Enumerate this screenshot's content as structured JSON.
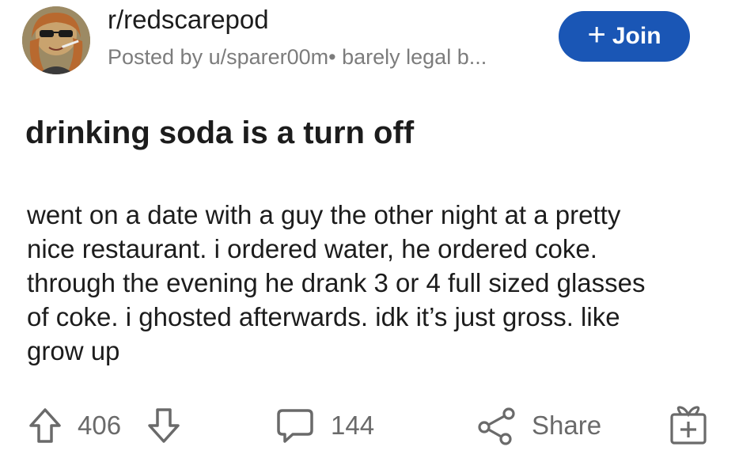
{
  "post": {
    "subreddit": "r/redscarepod",
    "posted_by": "Posted by u/sparer00m• barely legal b...",
    "join_label": "Join",
    "join_plus": "+",
    "title": "drinking soda is a turn off",
    "body_lines": [
      "went on a date with a guy the other night at a pretty",
      "nice restaurant. i ordered water, he ordered coke.",
      "through the evening he drank 3 or 4 full sized glasses",
      "of coke. i ghosted afterwards. idk it’s just gross. like",
      "grow up"
    ]
  },
  "footer": {
    "score": "406",
    "comments": "144",
    "share_label": "Share"
  },
  "icons": {
    "upvote": "upvote-arrow-icon",
    "downvote": "downvote-arrow-icon",
    "comment": "comment-bubble-icon",
    "share": "share-nodes-icon",
    "award": "award-gift-icon"
  },
  "colors": {
    "join_bg": "#1a56b5",
    "meta_text": "#7c7c7c",
    "icon_text": "#6a6a6a"
  }
}
